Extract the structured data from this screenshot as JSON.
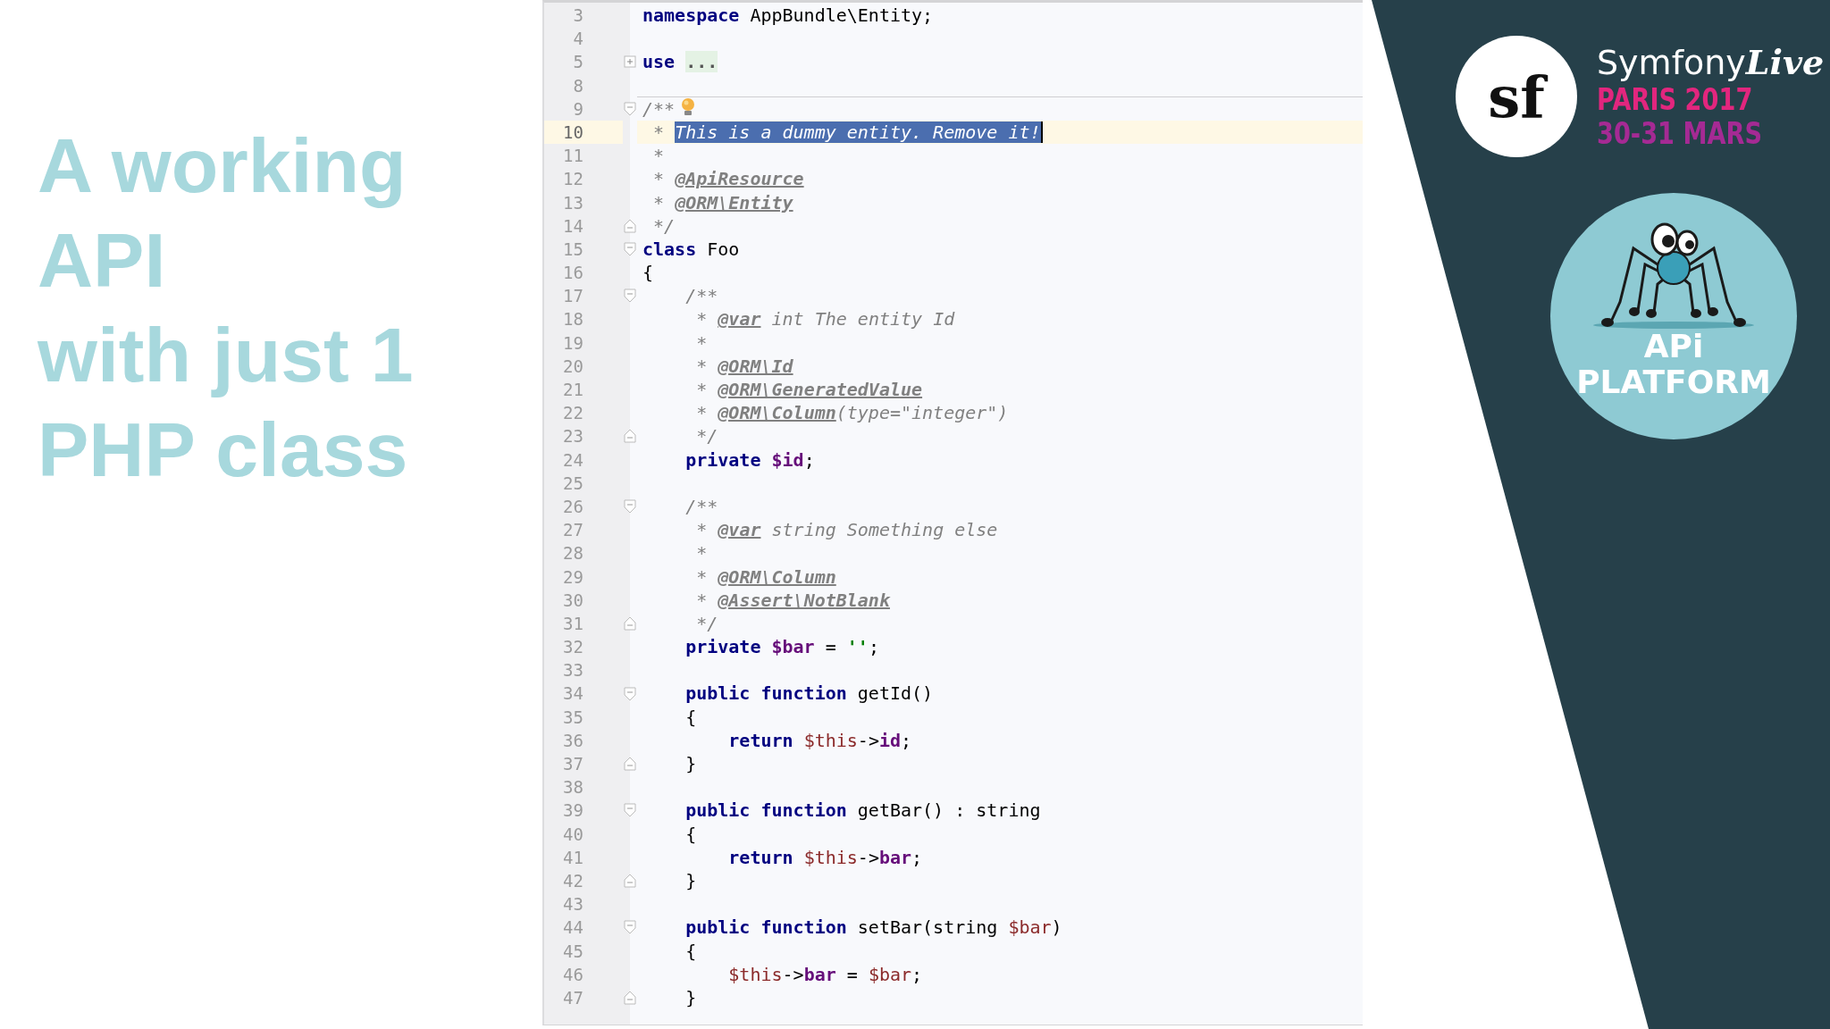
{
  "slide": {
    "title_lines": [
      "A working",
      "API",
      "with just 1",
      "PHP class"
    ]
  },
  "editor": {
    "lines": [
      {
        "number": "3",
        "tokens": [
          {
            "kind": "keyword",
            "text": "namespace"
          },
          {
            "kind": "plain",
            "text": " AppBundle\\Entity;"
          }
        ]
      },
      {
        "number": "4"
      },
      {
        "number": "5",
        "fold_marker": {
          "kind": "collapsed"
        },
        "tokens": [
          {
            "kind": "keyword",
            "text": "use "
          },
          {
            "kind": "folded",
            "text": "..."
          }
        ]
      },
      {
        "number": "8",
        "separator": true
      },
      {
        "number": "9",
        "fold_marker": {
          "kind": "start"
        },
        "bulb": true,
        "tokens": [
          {
            "kind": "comment",
            "text": "/**"
          }
        ]
      },
      {
        "number": "10",
        "current": true,
        "tokens": [
          {
            "kind": "comment",
            "text": " * "
          },
          {
            "kind": "selection",
            "text": "This is a dummy entity. Remove it!"
          }
        ]
      },
      {
        "number": "11",
        "tokens": [
          {
            "kind": "comment",
            "text": " *"
          }
        ]
      },
      {
        "number": "12",
        "tokens": [
          {
            "kind": "comment",
            "text": " * "
          },
          {
            "kind": "doctag",
            "text": "@ApiResource"
          }
        ]
      },
      {
        "number": "13",
        "tokens": [
          {
            "kind": "comment",
            "text": " * "
          },
          {
            "kind": "doctag",
            "text": "@ORM\\Entity"
          }
        ]
      },
      {
        "number": "14",
        "fold_marker": {
          "kind": "end"
        },
        "tokens": [
          {
            "kind": "comment",
            "text": " */"
          }
        ]
      },
      {
        "number": "15",
        "fold_marker": {
          "kind": "start"
        },
        "tokens": [
          {
            "kind": "keyword",
            "text": "class"
          },
          {
            "kind": "plain",
            "text": " Foo"
          }
        ]
      },
      {
        "number": "16",
        "tokens": [
          {
            "kind": "plain",
            "text": "{"
          }
        ]
      },
      {
        "number": "17",
        "fold_marker": {
          "kind": "start"
        },
        "tokens": [
          {
            "kind": "comment",
            "text": "    /**"
          }
        ]
      },
      {
        "number": "18",
        "tokens": [
          {
            "kind": "comment",
            "text": "     * "
          },
          {
            "kind": "doctag",
            "text": "@var"
          },
          {
            "kind": "comment",
            "text": " int The entity Id"
          }
        ]
      },
      {
        "number": "19",
        "tokens": [
          {
            "kind": "comment",
            "text": "     *"
          }
        ]
      },
      {
        "number": "20",
        "tokens": [
          {
            "kind": "comment",
            "text": "     * "
          },
          {
            "kind": "doctag",
            "text": "@ORM\\Id"
          }
        ]
      },
      {
        "number": "21",
        "tokens": [
          {
            "kind": "comment",
            "text": "     * "
          },
          {
            "kind": "doctag",
            "text": "@ORM\\GeneratedValue"
          }
        ]
      },
      {
        "number": "22",
        "tokens": [
          {
            "kind": "comment",
            "text": "     * "
          },
          {
            "kind": "doctag",
            "text": "@ORM\\Column"
          },
          {
            "kind": "comment",
            "text": "(type=\"integer\")"
          }
        ]
      },
      {
        "number": "23",
        "fold_marker": {
          "kind": "end"
        },
        "tokens": [
          {
            "kind": "comment",
            "text": "     */"
          }
        ]
      },
      {
        "number": "24",
        "tokens": [
          {
            "kind": "keyword",
            "text": "    private "
          },
          {
            "kind": "field",
            "text": "$id"
          },
          {
            "kind": "plain",
            "text": ";"
          }
        ]
      },
      {
        "number": "25"
      },
      {
        "number": "26",
        "fold_marker": {
          "kind": "start"
        },
        "tokens": [
          {
            "kind": "comment",
            "text": "    /**"
          }
        ]
      },
      {
        "number": "27",
        "tokens": [
          {
            "kind": "comment",
            "text": "     * "
          },
          {
            "kind": "doctag",
            "text": "@var"
          },
          {
            "kind": "comment",
            "text": " string Something else"
          }
        ]
      },
      {
        "number": "28",
        "tokens": [
          {
            "kind": "comment",
            "text": "     *"
          }
        ]
      },
      {
        "number": "29",
        "tokens": [
          {
            "kind": "comment",
            "text": "     * "
          },
          {
            "kind": "doctag",
            "text": "@ORM\\Column"
          }
        ]
      },
      {
        "number": "30",
        "tokens": [
          {
            "kind": "comment",
            "text": "     * "
          },
          {
            "kind": "doctag",
            "text": "@Assert\\NotBlank"
          }
        ]
      },
      {
        "number": "31",
        "fold_marker": {
          "kind": "end"
        },
        "tokens": [
          {
            "kind": "comment",
            "text": "     */"
          }
        ]
      },
      {
        "number": "32",
        "tokens": [
          {
            "kind": "keyword",
            "text": "    private "
          },
          {
            "kind": "field",
            "text": "$bar"
          },
          {
            "kind": "plain",
            "text": " = "
          },
          {
            "kind": "string",
            "text": "''"
          },
          {
            "kind": "plain",
            "text": ";"
          }
        ]
      },
      {
        "number": "33"
      },
      {
        "number": "34",
        "fold_marker": {
          "kind": "start"
        },
        "tokens": [
          {
            "kind": "keyword",
            "text": "    public function"
          },
          {
            "kind": "plain",
            "text": " getId()"
          }
        ]
      },
      {
        "number": "35",
        "tokens": [
          {
            "kind": "plain",
            "text": "    {"
          }
        ]
      },
      {
        "number": "36",
        "tokens": [
          {
            "kind": "keyword",
            "text": "        return "
          },
          {
            "kind": "local",
            "text": "$this"
          },
          {
            "kind": "plain",
            "text": "->"
          },
          {
            "kind": "field",
            "text": "id"
          },
          {
            "kind": "plain",
            "text": ";"
          }
        ]
      },
      {
        "number": "37",
        "fold_marker": {
          "kind": "end"
        },
        "tokens": [
          {
            "kind": "plain",
            "text": "    }"
          }
        ]
      },
      {
        "number": "38"
      },
      {
        "number": "39",
        "fold_marker": {
          "kind": "start"
        },
        "tokens": [
          {
            "kind": "keyword",
            "text": "    public function"
          },
          {
            "kind": "plain",
            "text": " getBar() : string"
          }
        ]
      },
      {
        "number": "40",
        "tokens": [
          {
            "kind": "plain",
            "text": "    {"
          }
        ]
      },
      {
        "number": "41",
        "tokens": [
          {
            "kind": "keyword",
            "text": "        return "
          },
          {
            "kind": "local",
            "text": "$this"
          },
          {
            "kind": "plain",
            "text": "->"
          },
          {
            "kind": "field",
            "text": "bar"
          },
          {
            "kind": "plain",
            "text": ";"
          }
        ]
      },
      {
        "number": "42",
        "fold_marker": {
          "kind": "end"
        },
        "tokens": [
          {
            "kind": "plain",
            "text": "    }"
          }
        ]
      },
      {
        "number": "43"
      },
      {
        "number": "44",
        "fold_marker": {
          "kind": "start"
        },
        "tokens": [
          {
            "kind": "keyword",
            "text": "    public function"
          },
          {
            "kind": "plain",
            "text": " setBar(string "
          },
          {
            "kind": "local",
            "text": "$bar"
          },
          {
            "kind": "plain",
            "text": ")"
          }
        ]
      },
      {
        "number": "45",
        "tokens": [
          {
            "kind": "plain",
            "text": "    {"
          }
        ]
      },
      {
        "number": "46",
        "tokens": [
          {
            "kind": "local",
            "text": "        $this"
          },
          {
            "kind": "plain",
            "text": "->"
          },
          {
            "kind": "field",
            "text": "bar"
          },
          {
            "kind": "plain",
            "text": " = "
          },
          {
            "kind": "local",
            "text": "$bar"
          },
          {
            "kind": "plain",
            "text": ";"
          }
        ]
      },
      {
        "number": "47",
        "fold_marker": {
          "kind": "end"
        },
        "tokens": [
          {
            "kind": "plain",
            "text": "    }"
          }
        ]
      }
    ]
  },
  "branding": {
    "symfony_logo": "sf",
    "event_name": "Symfony",
    "event_name_script": "Live",
    "city_year": "PARIS 2017",
    "dates": "30-31 MARS",
    "platform_logo_lines": [
      "APi",
      "PLATFORM"
    ]
  }
}
